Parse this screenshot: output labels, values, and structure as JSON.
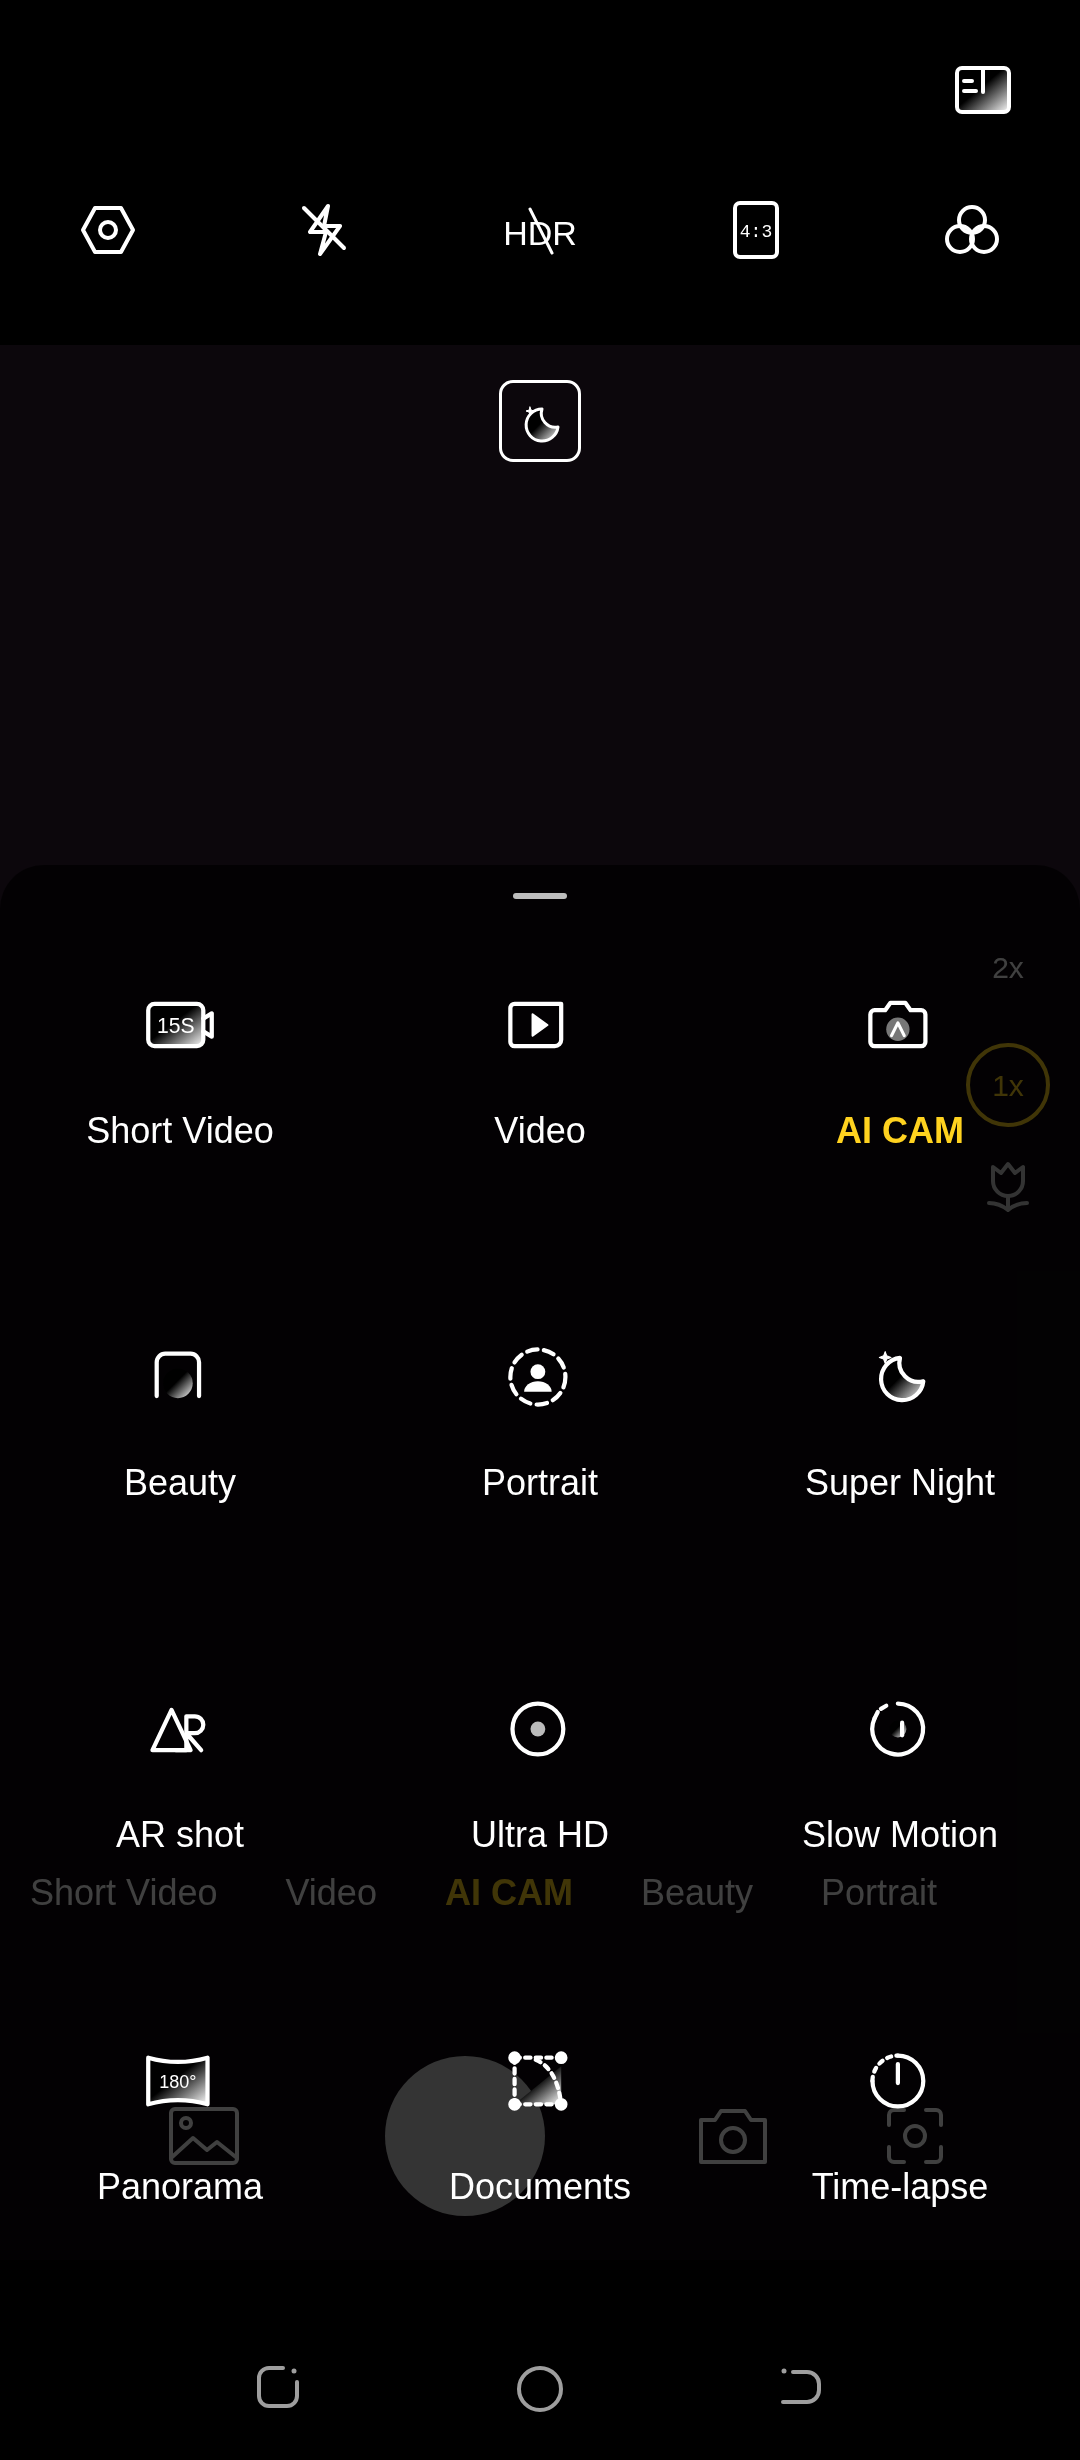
{
  "top_bar": {
    "flash": {
      "on": false
    },
    "hdr": {
      "label": "HDR",
      "on": false
    },
    "aspect_ratio": "4:3"
  },
  "viewfinder": {
    "zoom_levels": [
      {
        "label": "2x",
        "selected": false
      },
      {
        "label": "1x",
        "selected": true
      }
    ]
  },
  "mode_strip": [
    {
      "label": "Short Video",
      "selected": false
    },
    {
      "label": "Video",
      "selected": false
    },
    {
      "label": "AI CAM",
      "selected": true
    },
    {
      "label": "Beauty",
      "selected": false
    },
    {
      "label": "Portrait",
      "selected": false
    }
  ],
  "mode_sheet": {
    "modes": [
      {
        "label": "Short Video",
        "icon_text": "15S",
        "selected": false
      },
      {
        "label": "Video",
        "selected": false
      },
      {
        "label": "AI CAM",
        "selected": true
      },
      {
        "label": "Beauty",
        "selected": false
      },
      {
        "label": "Portrait",
        "selected": false
      },
      {
        "label": "Super Night",
        "selected": false
      },
      {
        "label": "AR shot",
        "selected": false
      },
      {
        "label": "Ultra HD",
        "selected": false
      },
      {
        "label": "Slow Motion",
        "selected": false
      },
      {
        "label": "Panorama",
        "icon_text": "180°",
        "selected": false
      },
      {
        "label": "Documents",
        "selected": false
      },
      {
        "label": "Time-lapse",
        "selected": false
      }
    ]
  }
}
